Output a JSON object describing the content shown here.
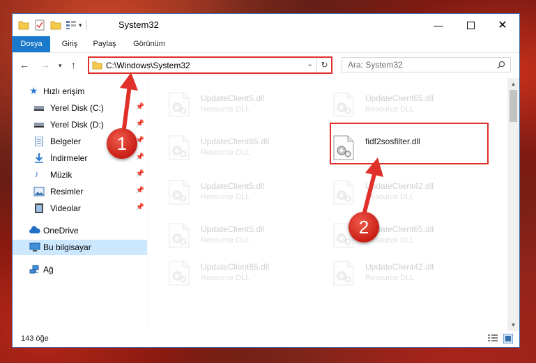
{
  "window": {
    "title": "System32",
    "controls": {
      "minimize_icon": "minimize-icon",
      "maximize_icon": "maximize-icon",
      "close_icon": "close-icon"
    }
  },
  "ribbon": {
    "tabs": [
      {
        "label": "Dosya",
        "active": true
      },
      {
        "label": "Giriş",
        "active": false
      },
      {
        "label": "Paylaş",
        "active": false
      },
      {
        "label": "Görünüm",
        "active": false
      }
    ]
  },
  "address": {
    "path": "C:\\Windows\\System32",
    "search_placeholder": "Ara: System32"
  },
  "sidebar": {
    "items": [
      {
        "label": "Hızlı erişim",
        "icon": "star-icon",
        "pinned": false
      },
      {
        "label": "Yerel Disk (C:)",
        "icon": "drive-icon",
        "pinned": true
      },
      {
        "label": "Yerel Disk (D:)",
        "icon": "drive-icon",
        "pinned": true
      },
      {
        "label": "Belgeler",
        "icon": "documents-icon",
        "pinned": true
      },
      {
        "label": "İndirmeler",
        "icon": "download-icon",
        "pinned": true
      },
      {
        "label": "Müzik",
        "icon": "music-icon",
        "pinned": true
      },
      {
        "label": "Resimler",
        "icon": "pictures-icon",
        "pinned": true
      },
      {
        "label": "Videolar",
        "icon": "videos-icon",
        "pinned": true
      },
      {
        "label": "OneDrive",
        "icon": "cloud-icon",
        "pinned": false
      },
      {
        "label": "Bu bilgisayar",
        "icon": "computer-icon",
        "pinned": false,
        "selected": true
      },
      {
        "label": "Ağ",
        "icon": "network-icon",
        "pinned": false
      }
    ]
  },
  "files": [
    {
      "name": "UpdateClient5.dll",
      "type": "Resource DLL",
      "faded": true
    },
    {
      "name": "UpdateClient65.dll",
      "type": "Resource DLL",
      "faded": true
    },
    {
      "name": "UpdateClient65.dll",
      "type": "Resource DLL",
      "faded": true
    },
    {
      "name": "fidf2sosfilter.dll",
      "type": "",
      "faded": false
    },
    {
      "name": "UpdateClient5.dll",
      "type": "Resource DLL",
      "faded": true
    },
    {
      "name": "UpdateClient42.dll",
      "type": "Resource DLL",
      "faded": true
    },
    {
      "name": "UpdateClient5.dll",
      "type": "Resource DLL",
      "faded": true
    },
    {
      "name": "UpdateClient65.dll",
      "type": "Resource DLL",
      "faded": true
    },
    {
      "name": "UpdateClient65.dll",
      "type": "Resource DLL",
      "faded": true
    },
    {
      "name": "UpdateClient42.dll",
      "type": "Resource DLL",
      "faded": true
    }
  ],
  "status": {
    "item_count": "143 öğe"
  },
  "annotations": {
    "step1": "1",
    "step2": "2"
  },
  "colors": {
    "accent": "#1979ca",
    "highlight_red": "#e0302a",
    "selected_bg": "#cce8ff"
  }
}
